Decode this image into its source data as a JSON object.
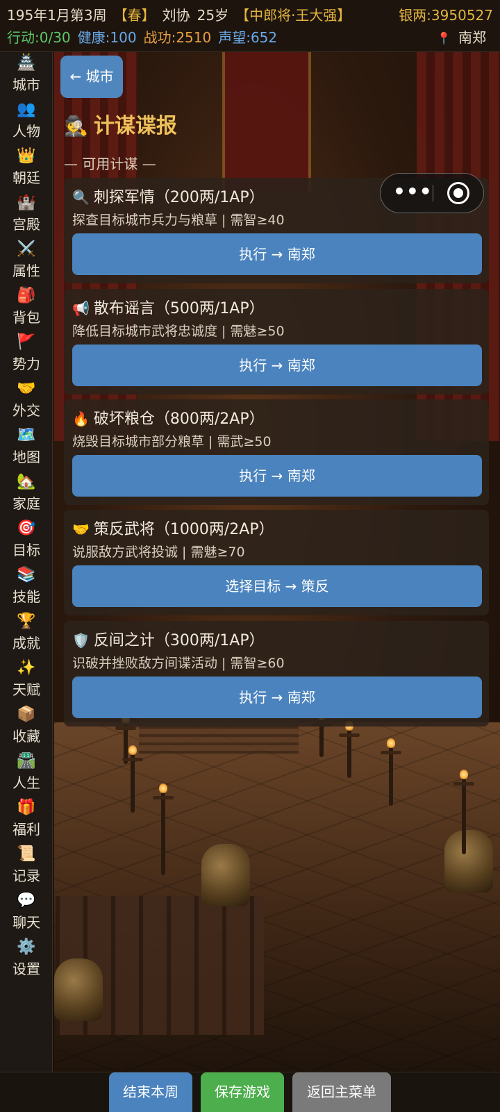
{
  "status": {
    "date": "195年1月第3周",
    "season": "【春】",
    "player_name": "刘协",
    "age": "25岁",
    "rank": "【中郎将·王大强】",
    "silver": "银两:3950527",
    "action_points": "行动:0/30",
    "health": "健康:100",
    "merit": "战功:2510",
    "prestige": "声望:652",
    "location": "南郑"
  },
  "sidebar": {
    "items": [
      {
        "icon": "city-icon",
        "label": "城市"
      },
      {
        "icon": "people-icon",
        "label": "人物"
      },
      {
        "icon": "crown-icon",
        "label": "朝廷"
      },
      {
        "icon": "palace-icon",
        "label": "宫殿"
      },
      {
        "icon": "swords-icon",
        "label": "属性"
      },
      {
        "icon": "backpack-icon",
        "label": "背包"
      },
      {
        "icon": "flag-icon",
        "label": "势力"
      },
      {
        "icon": "handshake-icon",
        "label": "外交"
      },
      {
        "icon": "map-icon",
        "label": "地图"
      },
      {
        "icon": "house-icon",
        "label": "家庭"
      },
      {
        "icon": "target-icon",
        "label": "目标"
      },
      {
        "icon": "books-icon",
        "label": "技能"
      },
      {
        "icon": "trophy-icon",
        "label": "成就"
      },
      {
        "icon": "sparkles-icon",
        "label": "天赋"
      },
      {
        "icon": "box-icon",
        "label": "收藏"
      },
      {
        "icon": "road-icon",
        "label": "人生"
      },
      {
        "icon": "gift-icon",
        "label": "福利"
      },
      {
        "icon": "scroll-icon",
        "label": "记录"
      },
      {
        "icon": "chat-icon",
        "label": "聊天"
      },
      {
        "icon": "gear-icon",
        "label": "设置"
      }
    ]
  },
  "header": {
    "back_label": "← 城市",
    "title": "计谋谍报",
    "title_icon": "spy-icon",
    "section_label": "— 可用计谋 —"
  },
  "schemes": [
    {
      "icon": "magnifier-icon",
      "name": "刺探军情（200两/1AP）",
      "desc": "探查目标城市兵力与粮草 | 需智≥40",
      "action": "执行 → 南郑"
    },
    {
      "icon": "megaphone-icon",
      "name": "散布谣言（500两/1AP）",
      "desc": "降低目标城市武将忠诚度 | 需魅≥50",
      "action": "执行 → 南郑"
    },
    {
      "icon": "fire-icon",
      "name": "破坏粮仓（800两/2AP）",
      "desc": "烧毁目标城市部分粮草 | 需武≥50",
      "action": "执行 → 南郑"
    },
    {
      "icon": "handshake-icon",
      "name": "策反武将（1000两/2AP）",
      "desc": "说服敌方武将投诚 | 需魅≥70",
      "action": "选择目标 → 策反"
    },
    {
      "icon": "shield-icon",
      "name": "反间之计（300两/1AP）",
      "desc": "识破并挫败敌方间谍活动 | 需智≥60",
      "action": "执行 → 南郑"
    }
  ],
  "footer": {
    "end_week": "结束本周",
    "save_game": "保存游戏",
    "main_menu": "返回主菜单"
  },
  "colors": {
    "accent_blue": "#4a83bd",
    "title_gold": "#efc15a",
    "save_green": "#4cae4c",
    "menu_gray": "#7a7a7a"
  }
}
